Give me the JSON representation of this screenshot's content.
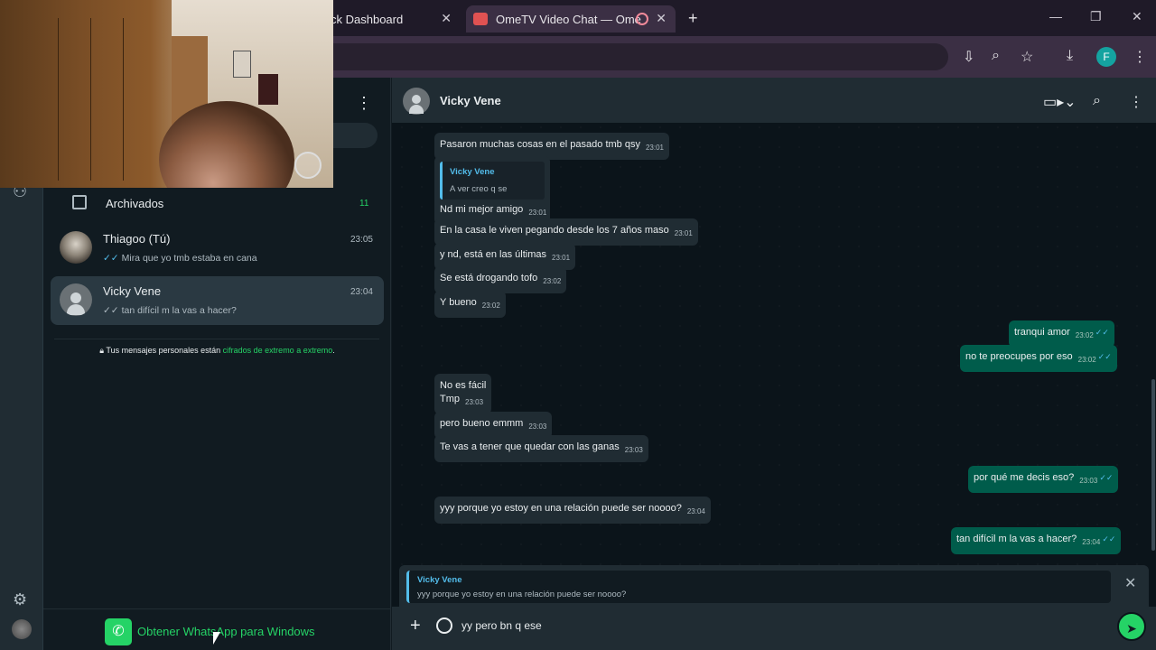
{
  "browser": {
    "tab1_title": "ck Dashboard",
    "tab2_title": "OmeTV Video Chat — Ome",
    "newtab": "+",
    "profile_initial": "F"
  },
  "sidebar": {
    "archived_label": "Archivados",
    "archived_count": "11",
    "chats": [
      {
        "name": "Thiagoo (Tú)",
        "time": "23:05",
        "preview": "Mira que yo tmb estaba en cana",
        "tick": "✓✓"
      },
      {
        "name": "Vicky Vene",
        "time": "23:04",
        "preview": "tan difícil m la vas a hacer?",
        "tick": "✓✓"
      }
    ],
    "encryption_prefix": "Tus mensajes personales están",
    "encryption_link": "cifrados de extremo a extremo",
    "encryption_suffix": ".",
    "get_app_label": "Obtener WhatsApp para Windows"
  },
  "conversation": {
    "contact_name": "Vicky Vene",
    "messages": [
      {
        "text": "Pasaron muchas cosas en el pasado tmb qsy",
        "time": "23:01"
      },
      {
        "quote_name": "Vicky Vene",
        "quote_text": "A ver creo q se",
        "text": "Nd mi mejor amigo",
        "time": "23:01"
      },
      {
        "text": "En la casa le viven pegando desde los 7 años maso",
        "time": "23:01"
      },
      {
        "text": "y nd, está en las últimas",
        "time": "23:01"
      },
      {
        "text": "Se está drogando tofo",
        "time": "23:02"
      },
      {
        "text": "Y bueno",
        "time": "23:02"
      },
      {
        "text": "tranqui amor",
        "time": "23:02"
      },
      {
        "text": "no te preocupes por eso",
        "time": "23:02"
      },
      {
        "text": "No es fácil",
        "text2": "Tmp",
        "time": "23:03"
      },
      {
        "text": "pero bueno emmm",
        "time": "23:03"
      },
      {
        "text": "Te vas a tener que quedar con las ganas",
        "time": "23:03"
      },
      {
        "text": "por qué me decis eso?",
        "time": "23:03"
      },
      {
        "text": "yyy porque yo estoy en una relación puede ser noooo?",
        "time": "23:04"
      },
      {
        "text": "tan difícil m la vas a hacer?",
        "time": "23:04"
      }
    ],
    "reply_preview": {
      "name": "Vicky Vene",
      "text": "yyy porque yo estoy en una relación puede ser noooo?"
    },
    "composer_text": "yy pero bn q ese",
    "read_ticks": "✓✓"
  },
  "colors": {
    "accent_green": "#25d366",
    "outgoing_bubble": "#005c4b",
    "incoming_bubble": "#202c33",
    "read_tick_blue": "#53bdeb"
  }
}
